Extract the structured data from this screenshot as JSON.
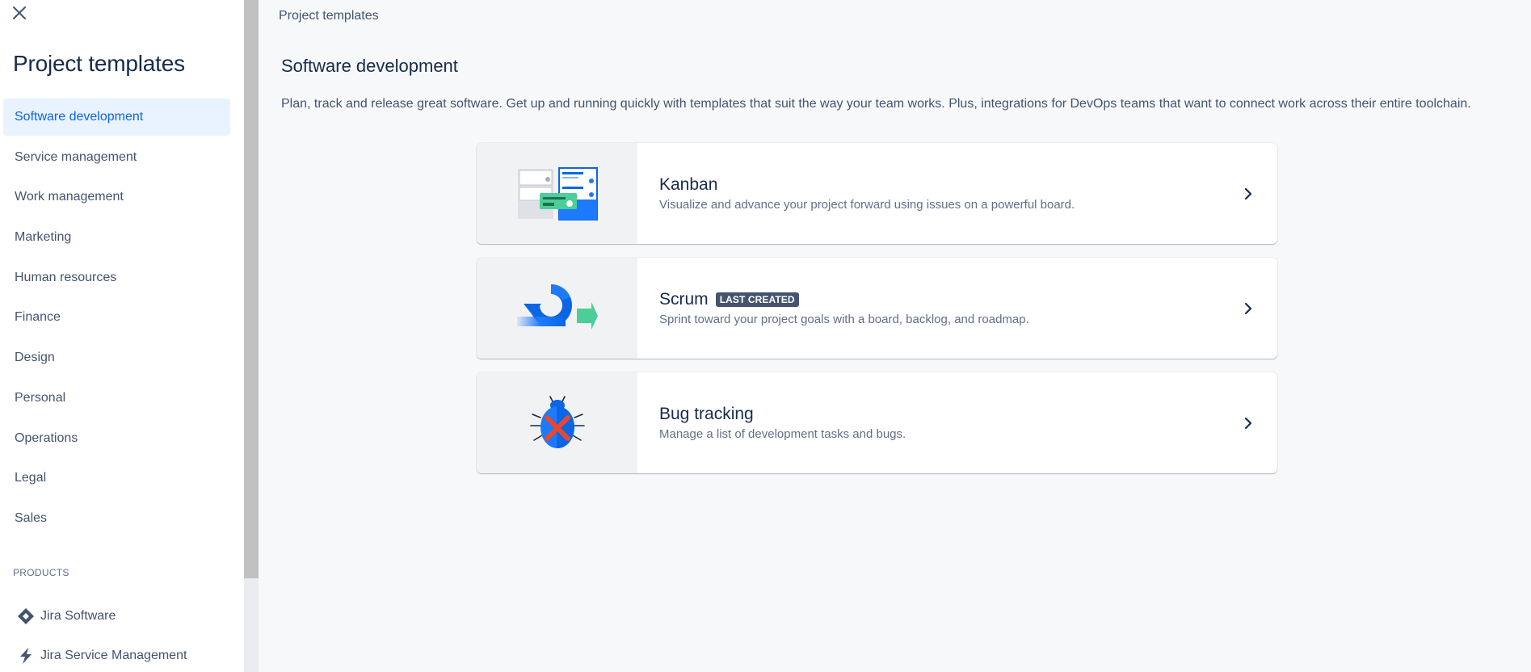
{
  "sidebar": {
    "title": "Project templates",
    "categories": [
      {
        "label": "Software development",
        "active": true
      },
      {
        "label": "Service management",
        "active": false
      },
      {
        "label": "Work management",
        "active": false
      },
      {
        "label": "Marketing",
        "active": false
      },
      {
        "label": "Human resources",
        "active": false
      },
      {
        "label": "Finance",
        "active": false
      },
      {
        "label": "Design",
        "active": false
      },
      {
        "label": "Personal",
        "active": false
      },
      {
        "label": "Operations",
        "active": false
      },
      {
        "label": "Legal",
        "active": false
      },
      {
        "label": "Sales",
        "active": false
      }
    ],
    "products_label": "PRODUCTS",
    "products": [
      {
        "label": "Jira Software",
        "icon": "jira-software-icon"
      },
      {
        "label": "Jira Service Management",
        "icon": "jira-service-management-icon"
      }
    ]
  },
  "main": {
    "breadcrumb": "Project templates",
    "section_title": "Software development",
    "section_description": "Plan, track and release great software. Get up and running quickly with templates that suit the way your team works. Plus, integrations for DevOps teams that want to connect work across their entire toolchain.",
    "templates": [
      {
        "title": "Kanban",
        "description": "Visualize and advance your project forward using issues on a powerful board.",
        "badge": "",
        "icon": "kanban-illustration"
      },
      {
        "title": "Scrum",
        "description": "Sprint toward your project goals with a board, backlog, and roadmap.",
        "badge": "LAST CREATED",
        "icon": "scrum-illustration"
      },
      {
        "title": "Bug tracking",
        "description": "Manage a list of development tasks and bugs.",
        "badge": "",
        "icon": "bug-tracking-illustration"
      }
    ]
  },
  "colors": {
    "active_nav_bg": "#e9f2ff",
    "active_nav_text": "#0c66e4",
    "text_primary": "#172b4d",
    "text_secondary": "#44546f",
    "lozenge_bg": "#44546f",
    "page_bg": "#f7f8f9"
  }
}
